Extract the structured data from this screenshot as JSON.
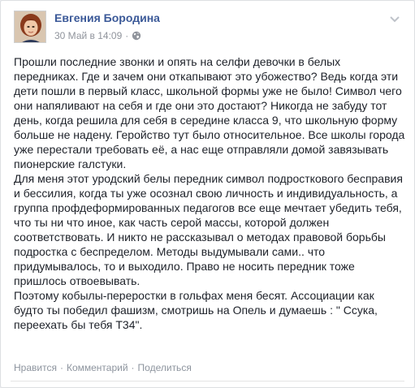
{
  "post": {
    "author": "Евгения Бородина",
    "timestamp": "30 Май в 14:09",
    "meta_separator": "·",
    "privacy_icon": "globe-icon",
    "options_icon": "chevron-down-icon",
    "paragraphs": [
      "Прошли последние звонки и опять на селфи девочки в белых передниках. Где и зачем они откапывают это убожество? Ведь когда эти дети пошли в первый класс, школьной формы уже не было! Символ чего они напяливают на себя и где они это достают? Никогда не забуду тот день, когда решила для себя в середине класса 9, что школьную форму больше не надену. Геройство тут было относительное. Все школы города уже перестали требовать её, а нас еще отправляли домой завязывать пионерские галстуки.",
      "Для меня этот уродский белы передник символ подросткового бесправия и бессилия, когда ты уже осознал свою личность и индивидуальность, а группа профдеформированных педагогов все еще мечтает убедить тебя, что ты ни что иное, как часть серой массы, которой должен соответствовать. И никто не рассказывал о методах правовой борьбы подростка с беспределом. Методы выдумывали сами.. что придумывалось, то и выходило. Право не носить передник тоже пришлось отвоевывать.",
      "Поэтому кобылы-переростки в гольфах меня бесят. Ассоциации как будто ты победил фашизм, смотришь на Опель и думаешь : \" Ссука, переехать бы тебя Т34\"."
    ]
  },
  "actions": {
    "like": "Нравится",
    "comment": "Комментарий",
    "share": "Поделиться",
    "separator": "·"
  },
  "colors": {
    "author": "#3b5998",
    "meta": "#90949c",
    "text": "#1d2129",
    "actions": "#8d949e"
  }
}
